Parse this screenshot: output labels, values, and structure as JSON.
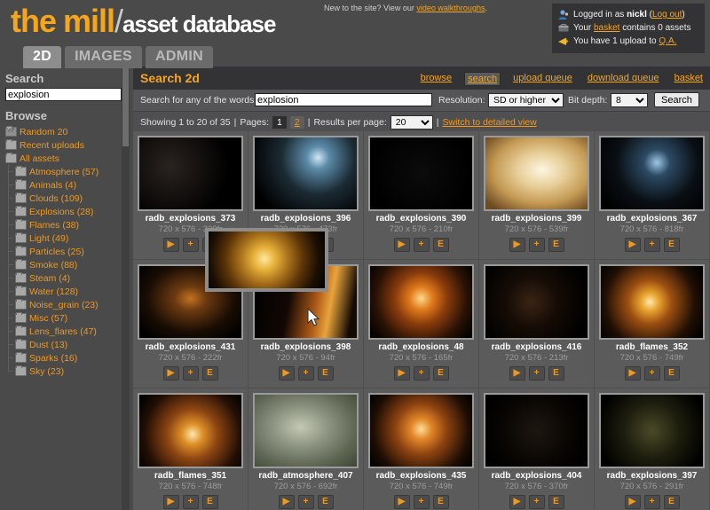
{
  "header": {
    "logo_the": "the",
    "logo_mill": "mill",
    "logo_slash": "/",
    "logo_sub": "asset database",
    "promo_text": "New to the site? View our",
    "promo_link": "video walkthroughs",
    "promo_end": ".",
    "account": {
      "logged_prefix": "Logged in as",
      "username": "nickl",
      "logout_open": "(",
      "logout_label": "Log out",
      "logout_close": ")",
      "basket_prefix": "Your",
      "basket_link": "basket",
      "basket_suffix": "contains 0 assets",
      "qa_prefix": "You have 1 upload to",
      "qa_link": "Q.A."
    }
  },
  "tabs": [
    {
      "label": "2D",
      "active": true
    },
    {
      "label": "IMAGES",
      "active": false
    },
    {
      "label": "ADMIN",
      "active": false
    }
  ],
  "sidebar": {
    "search_heading": "Search",
    "search_value": "explosion",
    "browse_heading": "Browse",
    "tree": [
      {
        "label": "Random 20",
        "icon": "question-folder-icon",
        "level": 0
      },
      {
        "label": "Recent uploads",
        "icon": "folder-icon",
        "level": 0
      },
      {
        "label": "All assets",
        "icon": "folder-icon",
        "level": 0
      },
      {
        "label": "Atmosphere (57)",
        "icon": "folder-icon",
        "level": 1
      },
      {
        "label": "Animals (4)",
        "icon": "folder-icon",
        "level": 1
      },
      {
        "label": "Clouds (109)",
        "icon": "folder-icon",
        "level": 1
      },
      {
        "label": "Explosions (28)",
        "icon": "folder-icon",
        "level": 1
      },
      {
        "label": "Flames (38)",
        "icon": "folder-icon",
        "level": 1
      },
      {
        "label": "Light (49)",
        "icon": "folder-icon",
        "level": 1
      },
      {
        "label": "Particles (25)",
        "icon": "folder-icon",
        "level": 1
      },
      {
        "label": "Smoke (88)",
        "icon": "folder-icon",
        "level": 1
      },
      {
        "label": "Steam (4)",
        "icon": "folder-icon",
        "level": 1
      },
      {
        "label": "Water (128)",
        "icon": "folder-icon",
        "level": 1
      },
      {
        "label": "Noise_grain (23)",
        "icon": "folder-icon",
        "level": 1
      },
      {
        "label": "Misc (57)",
        "icon": "folder-icon",
        "level": 1
      },
      {
        "label": "Lens_flares (47)",
        "icon": "folder-icon",
        "level": 1
      },
      {
        "label": "Dust (13)",
        "icon": "folder-icon",
        "level": 1
      },
      {
        "label": "Sparks (16)",
        "icon": "folder-icon",
        "level": 1
      },
      {
        "label": "Sky (23)",
        "icon": "folder-icon",
        "level": 1
      }
    ]
  },
  "main": {
    "title": "Search 2d",
    "nav": [
      {
        "label": "browse",
        "selected": false
      },
      {
        "label": "search",
        "selected": true
      },
      {
        "label": "upload queue",
        "selected": false
      },
      {
        "label": "download queue",
        "selected": false
      },
      {
        "label": "basket",
        "selected": false
      }
    ],
    "search_form": {
      "label": "Search for any of the words:",
      "value": "explosion",
      "resolution_label": "Resolution:",
      "resolution_value": "SD or higher",
      "bitdepth_label": "Bit depth:",
      "bitdepth_value": "8",
      "submit_label": "Search"
    },
    "results_bar": {
      "showing": "Showing 1 to 20 of 35",
      "sep1": "|",
      "pages_label": "Pages:",
      "page_current": "1",
      "page_other": "2",
      "sep2": "|",
      "per_page_label": "Results per page:",
      "per_page_value": "20",
      "sep3": "|",
      "switch_link": "Switch to detailed view"
    },
    "actions": {
      "play": "▶",
      "add": "+",
      "edit": "E"
    },
    "results": [
      {
        "name": "radb_explosions_373",
        "meta": "720 x 576 - 339fr",
        "bg": "sparks-dark"
      },
      {
        "name": "radb_explosions_396",
        "meta": "720 x 576 - 473fr",
        "bg": "blue-burst"
      },
      {
        "name": "radb_explosions_390",
        "meta": "720 x 576 - 210fr",
        "bg": "black-plain"
      },
      {
        "name": "radb_explosions_399",
        "meta": "720 x 576 - 539fr",
        "bg": "pale-glow"
      },
      {
        "name": "radb_explosions_367",
        "meta": "720 x 576 - 818fr",
        "bg": "blue-spark"
      },
      {
        "name": "radb_explosions_431",
        "meta": "720 x 576 - 222fr",
        "bg": "ember-field"
      },
      {
        "name": "radb_explosions_398",
        "meta": "720 x 576 - 94fr",
        "bg": "flame-streak"
      },
      {
        "name": "radb_explosions_48",
        "meta": "720 x 576 - 165fr",
        "bg": "fireball"
      },
      {
        "name": "radb_explosions_416",
        "meta": "720 x 576 - 213fr",
        "bg": "debris"
      },
      {
        "name": "radb_flames_352",
        "meta": "720 x 576 - 749fr",
        "bg": "flame-burst"
      },
      {
        "name": "radb_flames_351",
        "meta": "720 x 576 - 748fr",
        "bg": "flame-cloud"
      },
      {
        "name": "radb_atmosphere_407",
        "meta": "720 x 576 - 692fr",
        "bg": "green-haze"
      },
      {
        "name": "radb_explosions_435",
        "meta": "720 x 576 - 749fr",
        "bg": "orange-blast"
      },
      {
        "name": "radb_explosions_404",
        "meta": "720 x 576 - 370fr",
        "bg": "dark-specks"
      },
      {
        "name": "radb_explosions_397",
        "meta": "720 x 576 - 291fr",
        "bg": "green-sparks"
      }
    ],
    "preview_popup": {
      "alt": "explosion-preview"
    }
  },
  "colors": {
    "accent_orange": "#f7a51b",
    "link_orange": "#f0991e",
    "page_bg": "#4a4a4a",
    "panel_bg": "#575757",
    "header_dark": "#333335"
  }
}
